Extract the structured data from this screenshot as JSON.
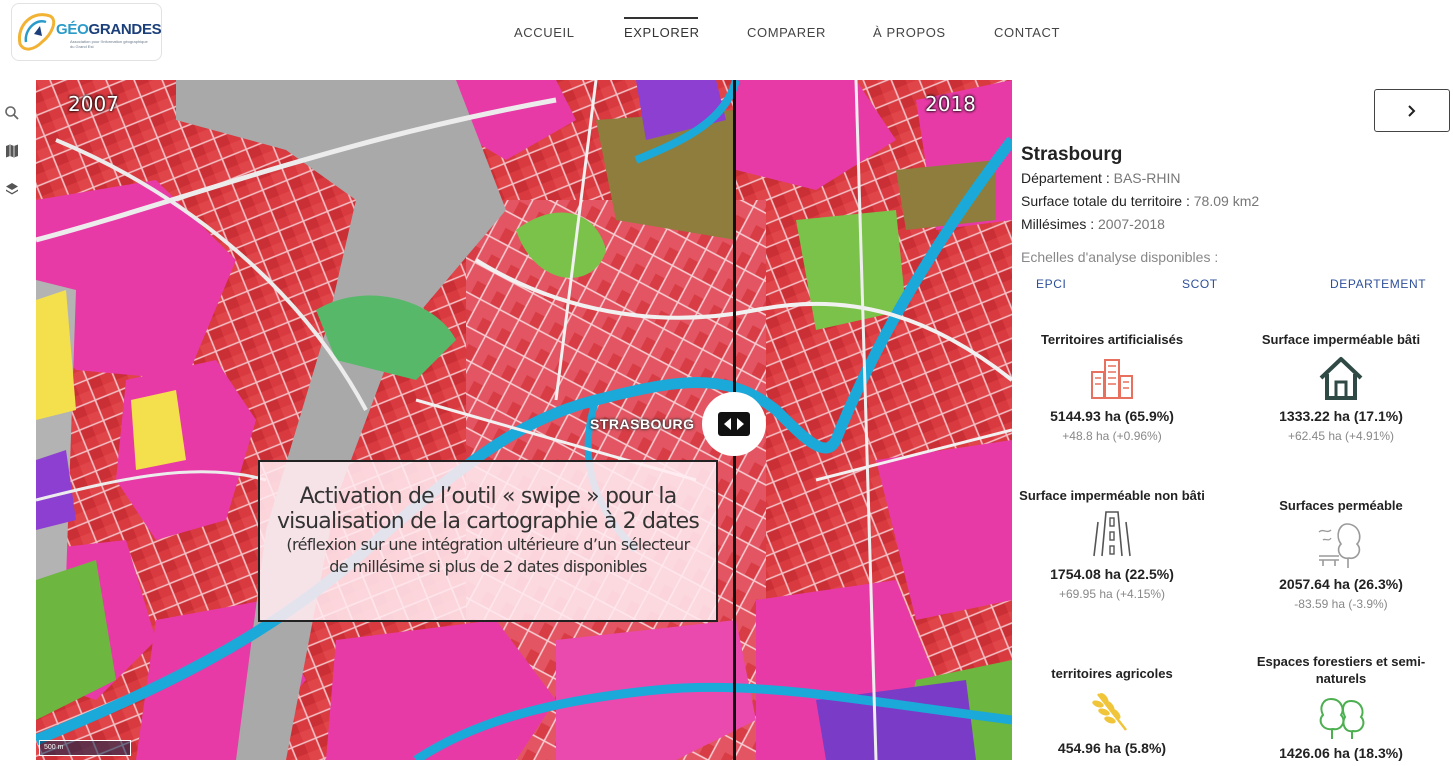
{
  "logo": {
    "part1": "GÉO",
    "part2": "GRANDEST",
    "sub": "Association pour l'information géographique du Grand Est"
  },
  "nav": [
    {
      "label": "ACCUEIL",
      "active": false
    },
    {
      "label": "EXPLORER",
      "active": true
    },
    {
      "label": "COMPARER",
      "active": false
    },
    {
      "label": "À PROPOS",
      "active": false
    },
    {
      "label": "CONTACT",
      "active": false
    }
  ],
  "toolbar": {
    "icons": [
      "search-icon",
      "map-icon",
      "layers-icon"
    ]
  },
  "map": {
    "year_left": "2007",
    "year_right": "2018",
    "city_label": "STRASBOURG",
    "scale": "500 m",
    "annotation": {
      "main": "Activation de l’outil « swipe » pour la visualisation de la cartographie à 2 dates",
      "sub": "(réflexion sur une intégration ultérieure d’un sélecteur de millésime si plus de 2 dates disponibles"
    }
  },
  "panel": {
    "toggle_icon": "chevron-right-icon",
    "city": "Strasbourg",
    "departement_label": "Département : ",
    "departement_value": "BAS-RHIN",
    "surface_label": "Surface totale du territoire : ",
    "surface_value": "78.09 km2",
    "millesimes_label": "Millésimes : ",
    "millesimes_value": "2007-2018",
    "scales_title": "Echelles d'analyse disponibles :",
    "scales": [
      "EPCI",
      "SCOT",
      "DEPARTEMENT"
    ],
    "cards": [
      {
        "title": "Territoires artificialisés",
        "value": "5144.93 ha (65.9%)",
        "delta": "+48.8 ha (+0.96%)",
        "icon": "buildings-icon",
        "color": "#e8705e"
      },
      {
        "title": "Surface imperméable bâti",
        "value": "1333.22 ha (17.1%)",
        "delta": "+62.45 ha (+4.91%)",
        "icon": "house-icon",
        "color": "#2f4a44"
      },
      {
        "title": "Surface imperméable non bâti",
        "value": "1754.08 ha (22.5%)",
        "delta": "+69.95 ha (+4.15%)",
        "icon": "road-icon",
        "color": "#555555"
      },
      {
        "title": "Surfaces perméable",
        "value": "2057.64 ha (26.3%)",
        "delta": "-83.59 ha (-3.9%)",
        "icon": "park-icon",
        "color": "#9a9a9a"
      },
      {
        "title": "territoires agricoles",
        "value": "454.96 ha (5.8%)",
        "delta": "",
        "icon": "wheat-icon",
        "color": "#f0c53a"
      },
      {
        "title": "Espaces forestiers et semi-naturels",
        "value": "1426.06 ha (18.3%)",
        "delta": "",
        "icon": "trees-icon",
        "color": "#4caf50"
      }
    ]
  }
}
